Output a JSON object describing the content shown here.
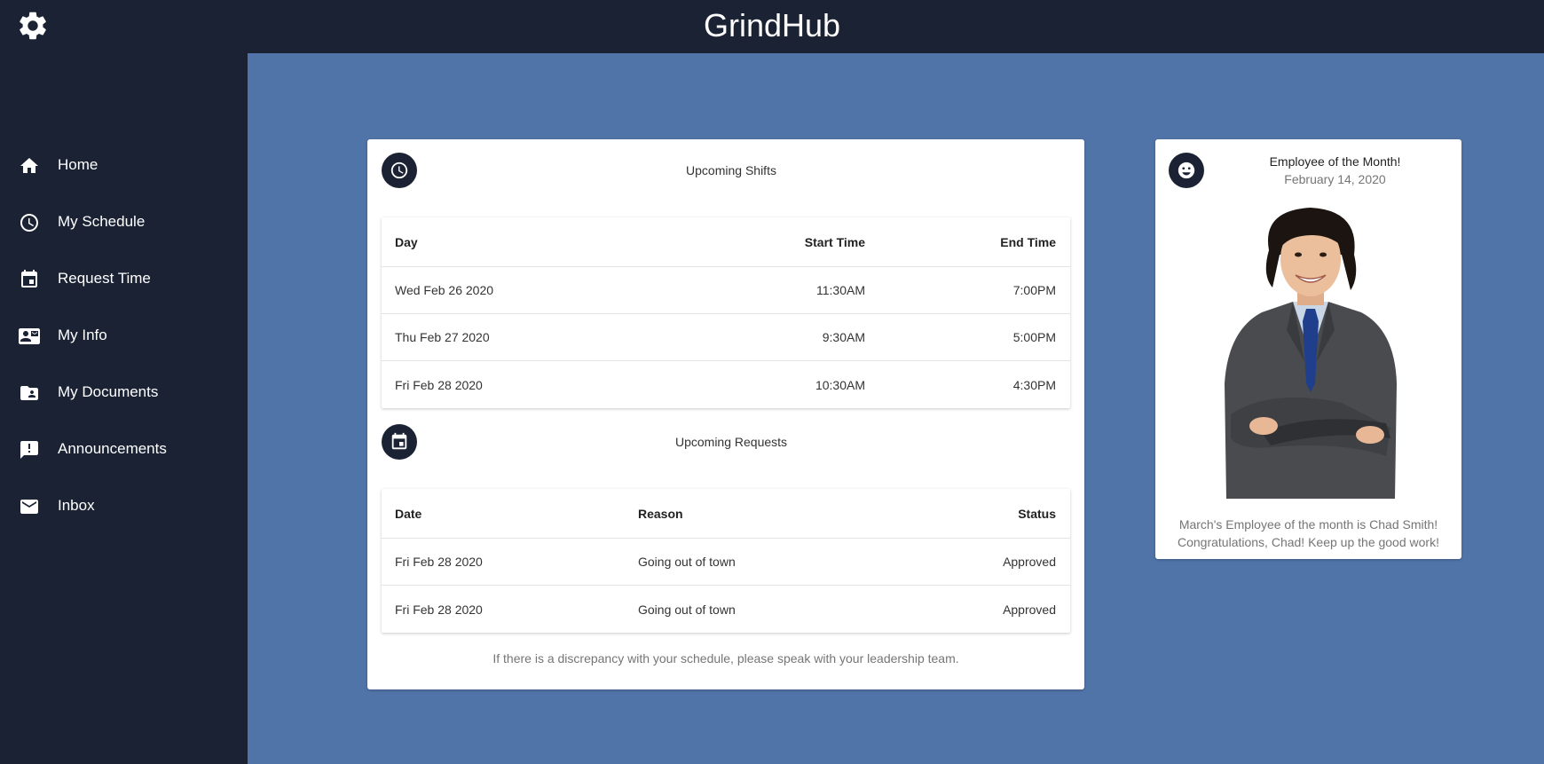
{
  "header": {
    "title": "GrindHub",
    "settings_icon": "gear-icon"
  },
  "sidebar": {
    "items": [
      {
        "label": "Home",
        "icon": "home-icon"
      },
      {
        "label": "My Schedule",
        "icon": "clock-icon"
      },
      {
        "label": "Request Time",
        "icon": "calendar-icon"
      },
      {
        "label": "My Info",
        "icon": "contact-card-icon"
      },
      {
        "label": "My Documents",
        "icon": "shared-folder-icon"
      },
      {
        "label": "Announcements",
        "icon": "announcement-icon"
      },
      {
        "label": "Inbox",
        "icon": "mail-icon"
      }
    ]
  },
  "shifts": {
    "title": "Upcoming Shifts",
    "icon": "clock-icon",
    "columns": [
      "Day",
      "Start Time",
      "End Time"
    ],
    "rows": [
      [
        "Wed Feb 26 2020",
        "11:30AM",
        "7:00PM"
      ],
      [
        "Thu Feb 27 2020",
        "9:30AM",
        "5:00PM"
      ],
      [
        "Fri Feb 28 2020",
        "10:30AM",
        "4:30PM"
      ]
    ]
  },
  "requests": {
    "title": "Upcoming Requests",
    "icon": "calendar-icon",
    "columns": [
      "Date",
      "Reason",
      "Status"
    ],
    "rows": [
      [
        "Fri Feb 28 2020",
        "Going out of town",
        "Approved"
      ],
      [
        "Fri Feb 28 2020",
        "Going out of town",
        "Approved"
      ]
    ]
  },
  "footnote": "If there is a discrepancy with your schedule, please speak with your leadership team.",
  "employee_of_month": {
    "title": "Employee of the Month!",
    "date": "February 14, 2020",
    "icon": "smiley-icon",
    "message_line1": "March's Employee of the month is Chad Smith!",
    "message_line2": "Congratulations, Chad! Keep up the good work!"
  },
  "colors": {
    "navy": "#1a2234",
    "background": "#5174a8",
    "card": "#ffffff"
  }
}
